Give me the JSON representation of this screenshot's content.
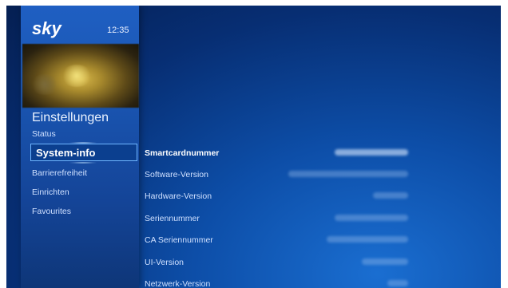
{
  "header": {
    "logo_text": "sky",
    "clock": "12:35"
  },
  "sidebar": {
    "section_title": "Einstellungen",
    "items": [
      {
        "label": "Status",
        "active": false
      },
      {
        "label": "System-info",
        "active": true
      },
      {
        "label": "Barrierefreiheit",
        "active": false
      },
      {
        "label": "Einrichten",
        "active": false
      },
      {
        "label": "Favourites",
        "active": false
      }
    ]
  },
  "system_info": {
    "rows": [
      {
        "label": "Smartcardnummer",
        "value": ""
      },
      {
        "label": "Software-Version",
        "value": ""
      },
      {
        "label": "Hardware-Version",
        "value": ""
      },
      {
        "label": "Seriennummer",
        "value": ""
      },
      {
        "label": "CA Seriennummer",
        "value": ""
      },
      {
        "label": "UI-Version",
        "value": ""
      },
      {
        "label": "Netzwerk-Version",
        "value": ""
      }
    ]
  },
  "colors": {
    "background": "#072e73",
    "sidebar": "#1a56b3",
    "active_border": "#6fb6ff"
  }
}
